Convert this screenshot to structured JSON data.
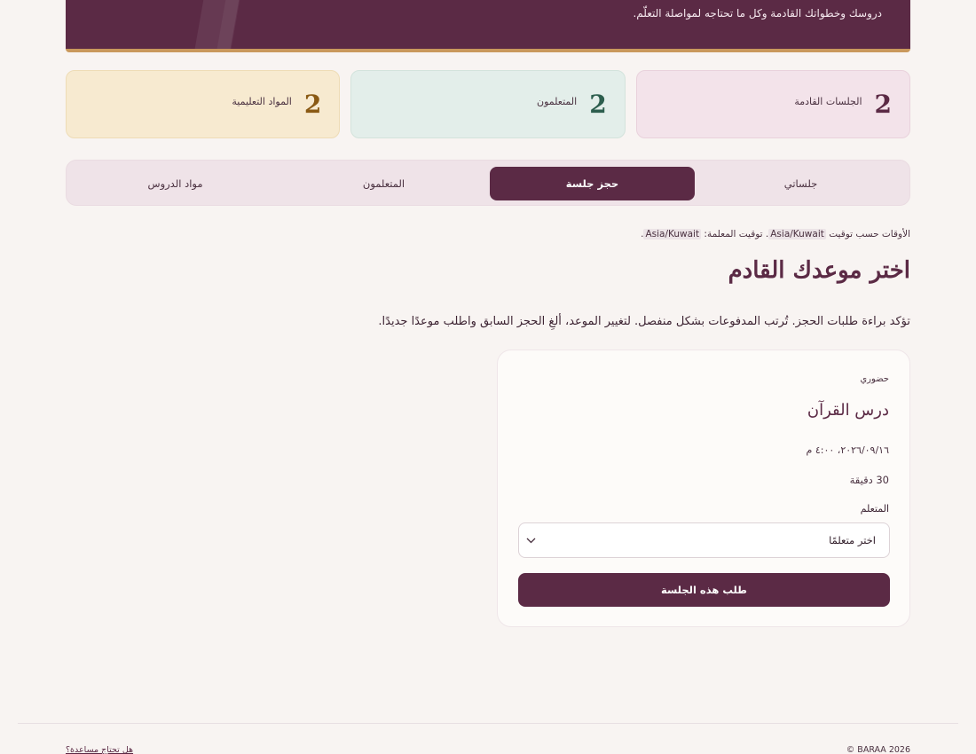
{
  "hero": {
    "subtitle": "دروسك وخطواتك القادمة وكل ما تحتاجه لمواصلة التعلّم."
  },
  "stats": [
    {
      "value": "2",
      "label": "الجلسات القادمة"
    },
    {
      "value": "2",
      "label": "المتعلمون"
    },
    {
      "value": "2",
      "label": "المواد التعليمية"
    }
  ],
  "tabs": [
    {
      "label": "جلساتي"
    },
    {
      "label": "حجز جلسة"
    },
    {
      "label": "المتعلمون"
    },
    {
      "label": "مواد الدروس"
    }
  ],
  "timezone": {
    "prefix": "الأوقات حسب توقيت",
    "zone": "Asia/Kuwait",
    "teacher_prefix": ". توقيت المعلمة:",
    "teacher_zone": "Asia/Kuwait",
    "suffix": "."
  },
  "page": {
    "title": "اختر موعدك القادم",
    "description": "تؤكد براءة طلبات الحجز. تُرتب المدفوعات بشكل منفصل. لتغيير الموعد، ألغِ الحجز السابق واطلب موعدًا جديدًا."
  },
  "session_card": {
    "mode": "حضوري",
    "lesson_name": "درس القرآن",
    "datetime": "٢٠٢٦/٠٩/١٦، ٤:٠٠ م",
    "duration": "30 دقيقة",
    "learner_label": "المتعلم",
    "learner_placeholder": "اختر متعلمًا",
    "request_button": "طلب هذه الجلسة"
  },
  "footer": {
    "copyright": "© BARAA 2026",
    "help_link": "هل تحتاج مساعدة؟"
  },
  "colors": {
    "brand": "#5b2a45",
    "accent": "#c9985c",
    "background": "#f8f4f2"
  },
  "icons": {
    "select_chevron": "chevron-down-icon"
  }
}
